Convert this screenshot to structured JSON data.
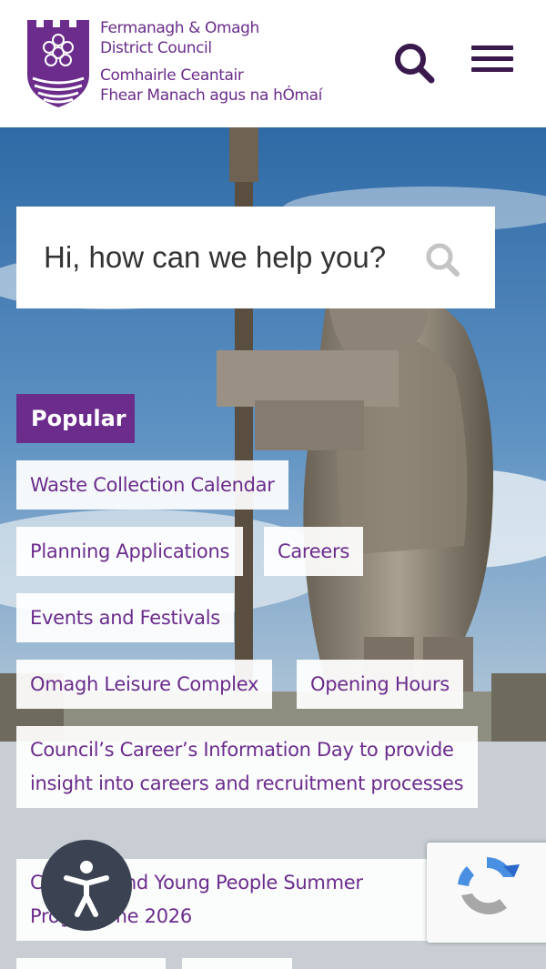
{
  "header": {
    "logo": {
      "name_en_line1": "Fermanagh & Omagh",
      "name_en_line2": "District Council",
      "name_ga_line1": "Comhairle Ceantair",
      "name_ga_line2": "Fhear Manach agus na hÓmaí"
    },
    "search_icon": "search-icon",
    "menu_icon": "hamburger-menu-icon"
  },
  "search": {
    "placeholder": "Hi, how can we help you?",
    "icon": "search-icon"
  },
  "popular": {
    "heading": "Popular",
    "links": [
      "Waste Collection Calendar",
      "Planning Applications",
      "Careers",
      "Events and Festivals",
      "Omagh Leisure Complex",
      "Opening Hours",
      "Council’s Career’s Information Day to provide insight into careers and recruitment processes",
      "Children and Young People Summer Programme 2026"
    ]
  },
  "colors": {
    "brand_purple": "#6b2c8c",
    "header_bg": "#ffffff",
    "accessibility_button": "#3b4252"
  },
  "widgets": {
    "accessibility_icon": "accessibility-person-icon",
    "recaptcha_icon": "recaptcha-icon"
  }
}
